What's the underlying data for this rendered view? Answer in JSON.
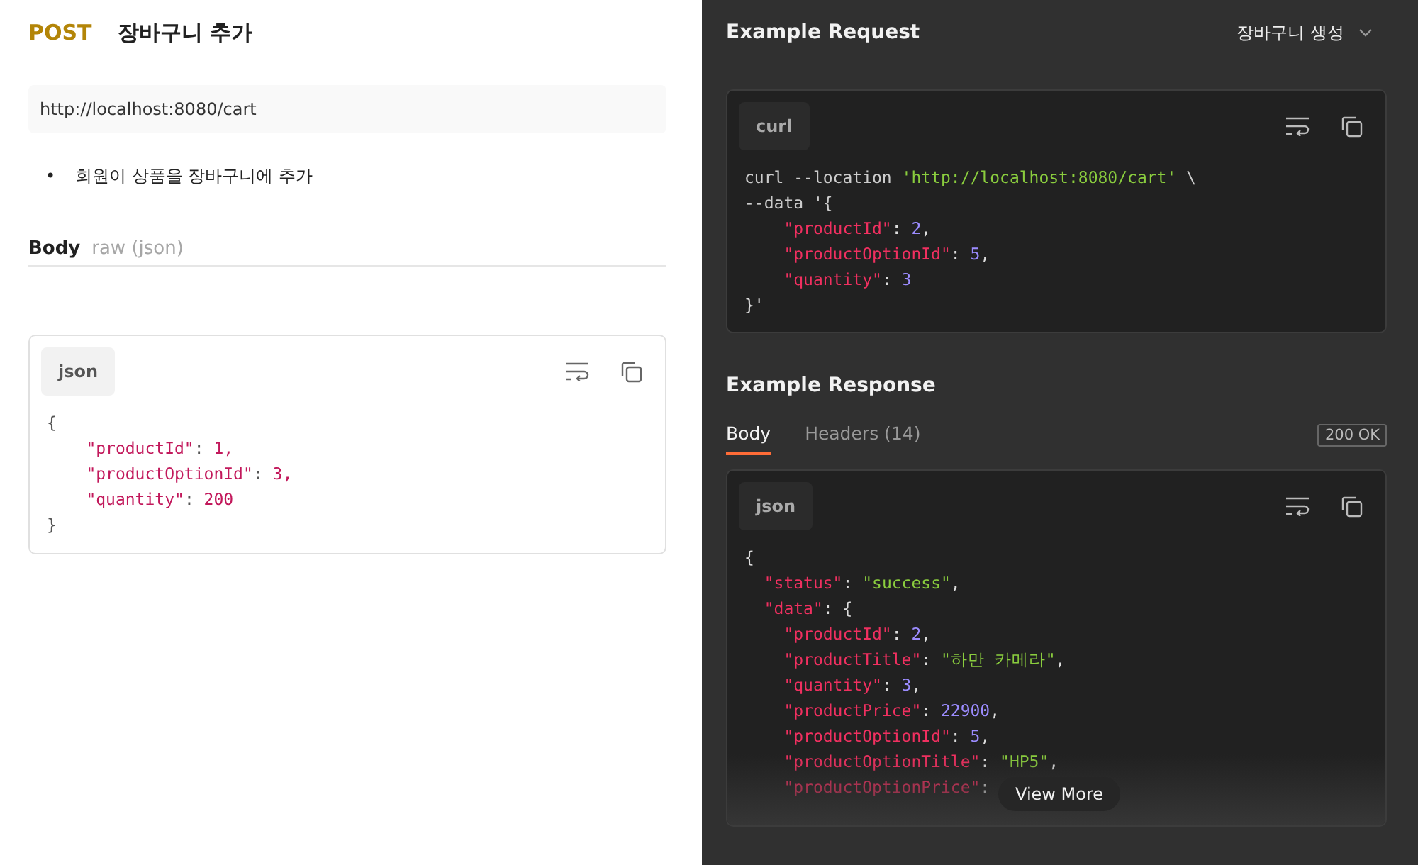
{
  "request": {
    "method": "POST",
    "title": "장바구니 추가",
    "url": "http://localhost:8080/cart",
    "description": [
      {
        "bullet": "•",
        "text": "회원이 상품을 장바구니에 추가"
      }
    ],
    "body": {
      "label": "Body",
      "mode": "raw (json)",
      "language": "json",
      "code": [
        [
          {
            "kind": "punct",
            "text": "{"
          }
        ],
        [
          {
            "kind": "key",
            "text": "    \"productId\""
          },
          {
            "kind": "punct",
            "text": ": "
          },
          {
            "kind": "number",
            "text": "1,"
          }
        ],
        [
          {
            "kind": "key",
            "text": "    \"productOptionId\""
          },
          {
            "kind": "punct",
            "text": ": "
          },
          {
            "kind": "number",
            "text": "3,"
          }
        ],
        [
          {
            "kind": "key",
            "text": "    \"quantity\""
          },
          {
            "kind": "punct",
            "text": ": "
          },
          {
            "kind": "number",
            "text": "200"
          }
        ],
        [
          {
            "kind": "punct",
            "text": "}"
          }
        ]
      ]
    }
  },
  "example_request": {
    "title": "Example Request",
    "example_name": "장바구니 생성",
    "language": "curl",
    "code": [
      [
        {
          "kind": "plain",
          "text": "curl --location "
        },
        {
          "kind": "string",
          "text": "'http://localhost:8080/cart'"
        },
        {
          "kind": "plain",
          "text": " \\"
        }
      ],
      [
        {
          "kind": "plain",
          "text": "--data '{"
        }
      ],
      [
        {
          "kind": "key",
          "text": "    \"productId\""
        },
        {
          "kind": "punct",
          "text": ": "
        },
        {
          "kind": "number",
          "text": "2"
        },
        {
          "kind": "punct",
          "text": ","
        }
      ],
      [
        {
          "kind": "key",
          "text": "    \"productOptionId\""
        },
        {
          "kind": "punct",
          "text": ": "
        },
        {
          "kind": "number",
          "text": "5"
        },
        {
          "kind": "punct",
          "text": ","
        }
      ],
      [
        {
          "kind": "key",
          "text": "    \"quantity\""
        },
        {
          "kind": "punct",
          "text": ": "
        },
        {
          "kind": "number",
          "text": "3"
        }
      ],
      [
        {
          "kind": "punct",
          "text": "}'"
        }
      ]
    ]
  },
  "example_response": {
    "title": "Example Response",
    "tabs": [
      {
        "label": "Body",
        "selected": true
      },
      {
        "label": "Headers (14)",
        "selected": false
      }
    ],
    "status": "200 OK",
    "language": "json",
    "view_more": "View More",
    "code": [
      [
        {
          "kind": "punct",
          "text": "{"
        }
      ],
      [
        {
          "kind": "key",
          "text": "  \"status\""
        },
        {
          "kind": "punct",
          "text": ": "
        },
        {
          "kind": "string",
          "text": "\"success\""
        },
        {
          "kind": "punct",
          "text": ","
        }
      ],
      [
        {
          "kind": "key",
          "text": "  \"data\""
        },
        {
          "kind": "punct",
          "text": ": {"
        }
      ],
      [
        {
          "kind": "key",
          "text": "    \"productId\""
        },
        {
          "kind": "punct",
          "text": ": "
        },
        {
          "kind": "number",
          "text": "2"
        },
        {
          "kind": "punct",
          "text": ","
        }
      ],
      [
        {
          "kind": "key",
          "text": "    \"productTitle\""
        },
        {
          "kind": "punct",
          "text": ": "
        },
        {
          "kind": "string",
          "text": "\"하만 카메라\""
        },
        {
          "kind": "punct",
          "text": ","
        }
      ],
      [
        {
          "kind": "key",
          "text": "    \"quantity\""
        },
        {
          "kind": "punct",
          "text": ": "
        },
        {
          "kind": "number",
          "text": "3"
        },
        {
          "kind": "punct",
          "text": ","
        }
      ],
      [
        {
          "kind": "key",
          "text": "    \"productPrice\""
        },
        {
          "kind": "punct",
          "text": ": "
        },
        {
          "kind": "number",
          "text": "22900"
        },
        {
          "kind": "punct",
          "text": ","
        }
      ],
      [
        {
          "kind": "key",
          "text": "    \"productOptionId\""
        },
        {
          "kind": "punct",
          "text": ": "
        },
        {
          "kind": "number",
          "text": "5"
        },
        {
          "kind": "punct",
          "text": ","
        }
      ],
      [
        {
          "kind": "key",
          "text": "    \"productOptionTitle\""
        },
        {
          "kind": "punct",
          "text": ": "
        },
        {
          "kind": "string",
          "text": "\"HP5\""
        },
        {
          "kind": "punct",
          "text": ","
        }
      ],
      [
        {
          "kind": "key",
          "text": "    \"productOptionPrice\""
        },
        {
          "kind": "punct",
          "text": ":"
        }
      ]
    ]
  }
}
